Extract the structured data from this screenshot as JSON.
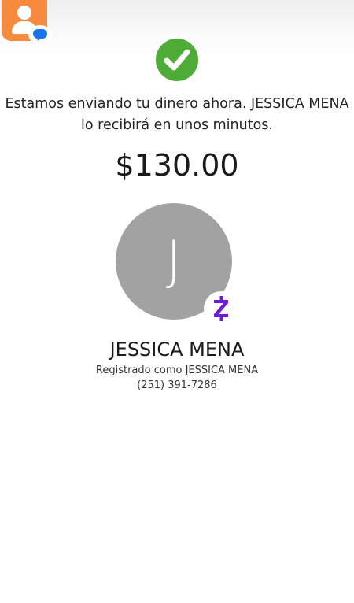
{
  "app": {
    "icon_name": "contacts-messaging-app-icon",
    "accent_color": "#f68b3d"
  },
  "status": {
    "icon_name": "checkmark-icon",
    "color": "#4eab37",
    "message_line1": "Estamos enviando tu dinero ahora. JESSICA MENA",
    "message_line2": "lo recibirá en unos minutos."
  },
  "payment": {
    "amount": "$130.00"
  },
  "recipient": {
    "initial": "J",
    "name": "JESSICA MENA",
    "registered_as": "Registrado como JESSICA MENA",
    "phone": "(251) 391-7286",
    "avatar_color": "#a2a2a2",
    "network_icon": "zelle-icon",
    "network_color": "#6d1ed4"
  }
}
